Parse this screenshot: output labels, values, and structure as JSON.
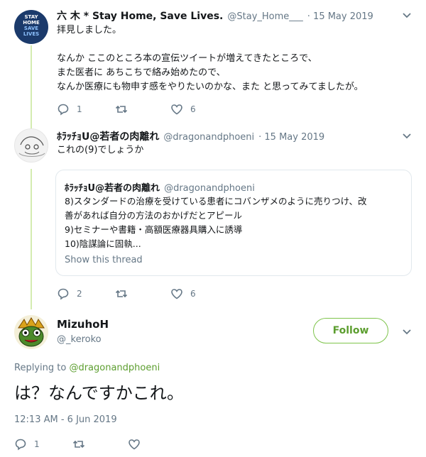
{
  "tweet1": {
    "name": "六 木 * Stay Home, Save Lives.",
    "handle": "@Stay_Home___",
    "date": "· 15 May 2019",
    "avatar_text": [
      "STAY",
      "HOME",
      "SAVE",
      "LIVES"
    ],
    "lines": [
      "拝見しました。",
      "",
      "なんか ここのところ本の宣伝ツイートが増えてきたところで、",
      "また医者に あちこちで絡み始めたので、",
      "なんか医療にも物申す感をやりたいのかな、また と思ってみてましたが。"
    ],
    "reply_count": "1",
    "like_count": "6"
  },
  "tweet2": {
    "name": "ﾎﾗｯﾁｮU@若者の肉離れ",
    "handle": "@dragonandphoeni",
    "date": "· 15 May 2019",
    "text": "これの(9)でしょうか",
    "reply_count": "2",
    "like_count": "6",
    "quote": {
      "name": "ﾎﾗｯﾁｮU@若者の肉離れ",
      "handle": "@dragonandphoeni",
      "lines": [
        "8)スタンダードの治療を受けている患者にコバンザメのように売りつけ、改",
        "善があれば自分の方法のおかげだとアピール",
        "9)セミナーや書籍・高額医療器具購入に誘導",
        "10)陰謀論に固執..."
      ],
      "show_thread": "Show this thread"
    }
  },
  "tweet3": {
    "name": "MizuhoH",
    "handle": "@_keroko",
    "follow_label": "Follow",
    "replying_prefix": "Replying to ",
    "replying_handle": "@dragonandphoeni",
    "text": "は？なんですかこれ。",
    "timestamp": "12:13 AM - 6 Jun 2019",
    "reply_count": "1"
  },
  "colors": {
    "accent": "#5c9e2f",
    "thread_line": "#d4ecb0",
    "muted": "#657786",
    "avatar1_bg": "#1b3a6b"
  }
}
